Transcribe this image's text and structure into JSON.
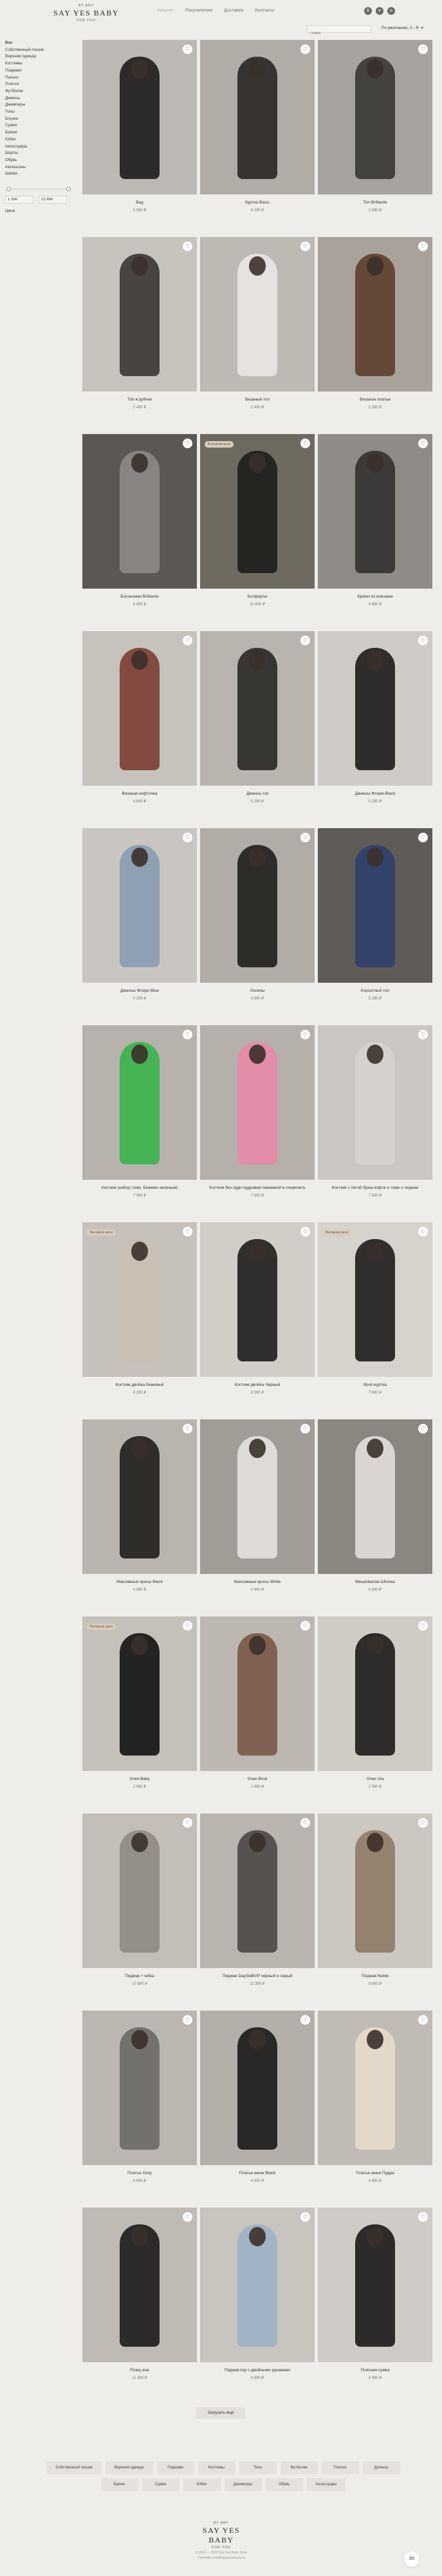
{
  "header": {
    "brand_small": "BY ANY",
    "brand_name": "SAY YES BABY",
    "brand_sub": "FOR YOU",
    "nav": [
      "Каталог",
      "Покупателям",
      "Доставка",
      "Контакты"
    ],
    "socials": [
      "vk-icon",
      "telegram-icon",
      "instagram-icon"
    ],
    "search_placeholder": "Поиск",
    "sort_label": "По умолчанию, А - Я"
  },
  "sidebar": {
    "categories": [
      "Все",
      "Собственный пошив",
      "Верхняя одежда",
      "Костюмы",
      "Пиджаки",
      "Пальто",
      "Платья",
      "Футболки",
      "Джинсы",
      "Джемперы",
      "Топы",
      "Блузки",
      "Сумки",
      "Брюки",
      "Юбки",
      "Аксессуары",
      "Шорты",
      "Обувь",
      "Капюшоны",
      "Шапки"
    ],
    "price_label": "Цена",
    "price_min": "1 390",
    "price_max": "22 890",
    "range_from": 0.0,
    "range_to": 1.0
  },
  "products": [
    {
      "name": "Bag",
      "price": "5 890 ₽",
      "badge": "",
      "bg": "#bcb9b4",
      "fig": "#1d1c1b"
    },
    {
      "name": "Куртка Basic",
      "price": "8 390 ₽",
      "badge": "",
      "bg": "#b1aca5",
      "fig": "#2a2723"
    },
    {
      "name": "Топ Brilliante",
      "price": "2 890 ₽",
      "badge": "",
      "bg": "#a7a39f",
      "fig": "#3a3733"
    },
    {
      "name": "Топ в рубчик",
      "price": "2 490 ₽",
      "badge": "",
      "bg": "#c7c3bd",
      "fig": "#3a3632"
    },
    {
      "name": "Вязаный топ",
      "price": "2 490 ₽",
      "badge": "",
      "bg": "#bdb9b3",
      "fig": "#e9e7e3"
    },
    {
      "name": "Вязаное платье",
      "price": "5 390 ₽",
      "badge": "",
      "bg": "#a9a29a",
      "fig": "#5c3f2e"
    },
    {
      "name": "Босоножки Brilliante",
      "price": "6 890 ₽",
      "badge": "",
      "bg": "#5a5754",
      "fig": "#8d8a86"
    },
    {
      "name": "Ботфорты",
      "price": "10 890 ₽",
      "badge": "Выгодная цена",
      "bg": "#6e6a5f",
      "fig": "#1f1e1c"
    },
    {
      "name": "Брюки из кожзама",
      "price": "4 890 ₽",
      "badge": "",
      "bg": "#8f8b86",
      "fig": "#333130"
    },
    {
      "name": "Вязаная кофточка",
      "price": "4 890 ₽",
      "badge": "",
      "bg": "#c6c2bc",
      "fig": "#7a3d32"
    },
    {
      "name": "Джинсы cut",
      "price": "5 290 ₽",
      "badge": "",
      "bg": "#b9b5ae",
      "fig": "#2a2826"
    },
    {
      "name": "Джинсы Флэри-Black",
      "price": "5 290 ₽",
      "badge": "",
      "bg": "#cfcbc6",
      "fig": "#1d1c1b"
    },
    {
      "name": "Джинсы Флэри-Blue",
      "price": "5 290 ₽",
      "badge": "",
      "bg": "#c9c6c1",
      "fig": "#8a9bb3"
    },
    {
      "name": "Лосины",
      "price": "4 590 ₽",
      "badge": "",
      "bg": "#b1aca5",
      "fig": "#1f1e1c"
    },
    {
      "name": "Корсетный топ",
      "price": "5 290 ₽",
      "badge": "",
      "bg": "#5f5c58",
      "fig": "#2e3f6e"
    },
    {
      "name": "Костюм (набор тоже, Бежево-зеленым)",
      "price": "7 690 ₽",
      "badge": "",
      "bg": "#b7b2ab",
      "fig": "#38b34a"
    },
    {
      "name": "Костюм без худи пудровая пажамкой в сноркоить",
      "price": "7 690 ₽",
      "badge": "",
      "bg": "#b5b0a9",
      "fig": "#e88aa8"
    },
    {
      "name": "Костюм с пятой брюк.кофта и тоже о пиджак",
      "price": "7 690 ₽",
      "badge": "",
      "bg": "#cac6c1",
      "fig": "#d6d3cf"
    },
    {
      "name": "Костюм двойка Бежевый",
      "price": "8 390 ₽",
      "badge": "Выгодная цена",
      "bg": "#c6c1ba",
      "fig": "#c9bfb1"
    },
    {
      "name": "Костюм двойка Черный",
      "price": "8 390 ₽",
      "badge": "",
      "bg": "#d1cdc7",
      "fig": "#1f1e1c"
    },
    {
      "name": "Кроп-куртка",
      "price": "7 690 ₽",
      "badge": "Выгодная цена",
      "bg": "#d6d2cc",
      "fig": "#1d1c1b"
    },
    {
      "name": "Массивные кросы Black",
      "price": "4 990 ₽",
      "badge": "",
      "bg": "#b9b4ad",
      "fig": "#1f1e1c"
    },
    {
      "name": "Массивные кросы White",
      "price": "4 990 ₽",
      "badge": "",
      "bg": "#a19c95",
      "fig": "#e6e3de"
    },
    {
      "name": "Мешковатая юбочка",
      "price": "4 890 ₽",
      "badge": "",
      "bg": "#8a8680",
      "fig": "#e2ded8"
    },
    {
      "name": "Очки Baby",
      "price": "2 990 ₽",
      "badge": "Выгодная цена",
      "bg": "#c4c0ba",
      "fig": "#121212"
    },
    {
      "name": "Очки Brod",
      "price": "2 990 ₽",
      "badge": "",
      "bg": "#bcb7b1",
      "fig": "#7a5848"
    },
    {
      "name": "Очки Ula",
      "price": "2 990 ₽",
      "badge": "",
      "bg": "#cfcbc5",
      "fig": "#1c1b1a"
    },
    {
      "name": "Пиджак + юбка",
      "price": "10 890 ₽",
      "badge": "",
      "bg": "#c3beb7",
      "fig": "#8f8a83"
    },
    {
      "name": "Пиджак DaySkiBVP черный и серый",
      "price": "11 390 ₽",
      "badge": "",
      "bg": "#b9b4ad",
      "fig": "#4b4844"
    },
    {
      "name": "Пиджак Noble",
      "price": "9 890 ₽",
      "badge": "",
      "bg": "#cbc7c1",
      "fig": "#8e7a66"
    },
    {
      "name": "Платье Grey",
      "price": "4 890 ₽",
      "badge": "",
      "bg": "#bbb6af",
      "fig": "#6c6964"
    },
    {
      "name": "Платье мини Black",
      "price": "4 890 ₽",
      "badge": "",
      "bg": "#b4afa8",
      "fig": "#1a1918"
    },
    {
      "name": "Платье мини Пудра",
      "price": "4 890 ₽",
      "badge": "",
      "bg": "#c0bbb4",
      "fig": "#e8dccd"
    },
    {
      "name": "Плащ кож",
      "price": "11 390 ₽",
      "badge": "",
      "bg": "#bfbab3",
      "fig": "#1d1c1b"
    },
    {
      "name": "Пиджак-top с двойными рукавами",
      "price": "4 990 ₽",
      "badge": "",
      "bg": "#c8c4be",
      "fig": "#9db1c7"
    },
    {
      "name": "Поясная сумка",
      "price": "4 990 ₽",
      "badge": "",
      "bg": "#cfcbc6",
      "fig": "#1a1918"
    }
  ],
  "more_label": "Загрузить ещё",
  "footer": {
    "categories": [
      "Собственный пошив",
      "Верхняя одежда",
      "Пиджаки",
      "Костюмы",
      "Топы",
      "Футболки",
      "Платья",
      "Джинсы",
      "Брюки",
      "Сумки",
      "Юбки",
      "Джемперы",
      "Обувь",
      "Аксессуары"
    ],
    "brand_small": "BY ANY",
    "brand_name": "SAY YES BABY",
    "brand_sub": "FOR YOU",
    "copy_line1": "© 2019 — 2022 Say Yes Baby Store",
    "copy_line2": "Политика конфиденциальности"
  }
}
